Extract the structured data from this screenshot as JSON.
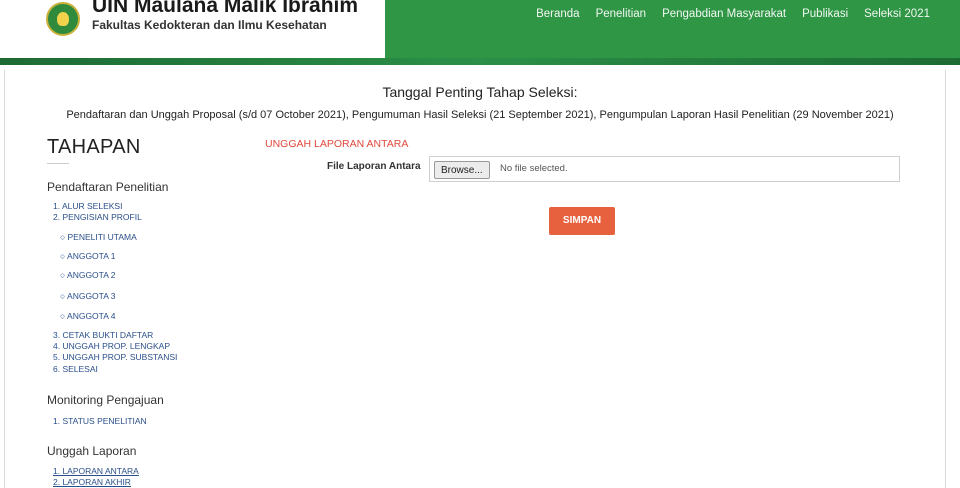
{
  "header": {
    "brand_title": "UIN Maulana Malik Ibrahim",
    "brand_subtitle": "Fakultas Kedokteran dan Ilmu Kesehatan",
    "nav": [
      "Beranda",
      "Penelitian",
      "Pengabdian Masyarakat",
      "Publikasi",
      "Seleksi 2021"
    ],
    "colors": {
      "green": "#2e9645",
      "accent": "#e8613f"
    }
  },
  "announcement": {
    "title": "Tanggal Penting Tahap Seleksi:",
    "text": "Pendaftaran dan Unggah Proposal (s/d 07 October 2021), Pengumuman Hasil Seleksi (21 September 2021), Pengumpulan Laporan Hasil Penelitian (29 November 2021)"
  },
  "sidebar": {
    "title": "TAHAPAN",
    "sections": [
      {
        "label": "Pendaftaran Penelitian",
        "items": [
          "1. ALUR SELEKSI",
          "2. PENGISIAN PROFIL",
          "PENELITI UTAMA",
          "ANGGOTA 1",
          "ANGGOTA 2",
          "ANGGOTA 3",
          "ANGGOTA 4",
          "3. CETAK BUKTI DAFTAR",
          "4. UNGGAH PROP. LENGKAP",
          "5. UNGGAH PROP. SUBSTANSI",
          "6. SELESAI"
        ]
      },
      {
        "label": "Monitoring Pengajuan",
        "items": [
          "1. STATUS PENELITIAN"
        ]
      },
      {
        "label": "Unggah Laporan",
        "items": [
          "1. LAPORAN ANTARA",
          "2. LAPORAN AKHIR"
        ]
      }
    ]
  },
  "main": {
    "form_title": "UNGGAH LAPORAN ANTARA",
    "file_label": "File Laporan Antara",
    "browse_label": "Browse...",
    "file_status": "No file selected.",
    "save_label": "SIMPAN"
  }
}
